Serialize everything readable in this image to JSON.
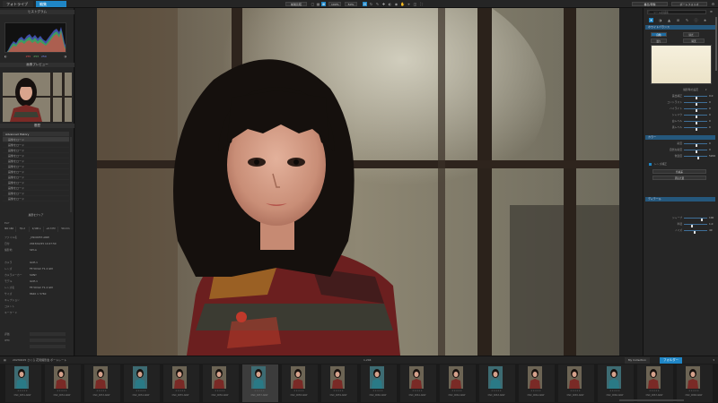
{
  "topbar": {
    "tabs": [
      "フォトライブラリ",
      "編集"
    ],
    "center_buttons": [
      "前後比較",
      "100%",
      "50%"
    ],
    "right_buttons": [
      "書出/現像",
      "ポートフォリオ"
    ]
  },
  "left": {
    "histogram_title": "ヒストグラム",
    "hist_values": {
      "r": "255",
      "g": "253",
      "b": "250"
    },
    "navigator_title": "画像プレビュー",
    "history_title": "履歴",
    "history_items": [
      "Advanced History",
      "画像をロード",
      "画像をロード",
      "画像をロード",
      "画像をロード",
      "画像をロード",
      "画像をロード",
      "画像をロード",
      "画像をロード",
      "画像をロード",
      "画像をロード",
      "画像をロード",
      "画像をロード"
    ],
    "history_footer": "履歴をクリア",
    "info_title": "Exif",
    "exif": [
      "ISO 160",
      "f/1.2",
      "1/100 s",
      "+0.3 EV",
      "50 mm"
    ],
    "meta_rows": [
      {
        "k": "ファイル名",
        "v": "_DSC0057.ARW"
      },
      {
        "k": "日付",
        "v": "2023/02/25 10:27:50"
      },
      {
        "k": "撮影地",
        "v": "SKY-A"
      },
      {
        "k": "カメラ",
        "v": "ILCE-1"
      },
      {
        "k": "レンズ",
        "v": "FE 50mm F1.2 GM"
      },
      {
        "k": "カメラメーカー",
        "v": "SONY"
      },
      {
        "k": "モデル",
        "v": "ILCE-1"
      },
      {
        "k": "レンズ名",
        "v": "FE 50mm F1.2 GM"
      },
      {
        "k": "サイズ",
        "v": "8640 × 5760"
      },
      {
        "k": "キャプション",
        "v": ""
      },
      {
        "k": "コメント",
        "v": ""
      },
      {
        "k": "キーワード",
        "v": ""
      },
      {
        "k": "評価",
        "v": ""
      },
      {
        "k": "IPTC",
        "v": ""
      }
    ]
  },
  "right": {
    "search_placeholder": "ツールを検索",
    "header_tool": "ホワイトバランス",
    "chips": [
      "自動",
      "昼光",
      "曇り",
      "晴天"
    ],
    "wb_mode": "撮影時の設定",
    "tone_title": "ライト",
    "tone_rows": [
      {
        "label": "露出補正",
        "value": "0.0"
      },
      {
        "label": "コントラスト",
        "value": "0"
      },
      {
        "label": "ハイライト",
        "value": "0"
      },
      {
        "label": "シャドウ",
        "value": "0"
      },
      {
        "label": "白レベル",
        "value": "0"
      },
      {
        "label": "黒レベル",
        "value": "0"
      }
    ],
    "color_title": "カラー",
    "color_rows": [
      {
        "label": "彩度",
        "value": "0"
      },
      {
        "label": "自然な彩度",
        "value": "0"
      },
      {
        "label": "色温度",
        "value": "5200"
      }
    ],
    "detail_title": "ディテール",
    "detail_rows": [
      {
        "label": "シャープ",
        "value": "100"
      },
      {
        "label": "半径",
        "value": "1.0"
      },
      {
        "label": "ノイズ",
        "value": "40"
      }
    ],
    "checkbox_label": "レンズ補正",
    "button1": "色収差",
    "button2": "周辺光量"
  },
  "filmbar": {
    "path": "20230225 さくら 花見撮影会 ポートレート",
    "count": "1,204",
    "tab_collection": "My Collection",
    "tab_active": "フォルダー"
  },
  "filmstrip": [
    "DSC_0051.ARW",
    "DSC_0052.ARW",
    "DSC_0053.ARW",
    "DSC_0054.ARW",
    "DSC_0055.ARW",
    "DSC_0056.ARW",
    "DSC_0057.ARW",
    "DSC_0058.ARW",
    "DSC_0059.ARW",
    "DSC_0060.ARW",
    "DSC_0061.ARW",
    "DSC_0062.ARW",
    "DSC_0063.ARW",
    "DSC_0064.ARW",
    "DSC_0065.ARW",
    "DSC_0066.ARW",
    "DSC_0067.ARW",
    "DSC_0068.ARW"
  ],
  "colors": {
    "accent": "#1f86c6",
    "panel": "#262626",
    "bg": "#1b1b1b"
  }
}
